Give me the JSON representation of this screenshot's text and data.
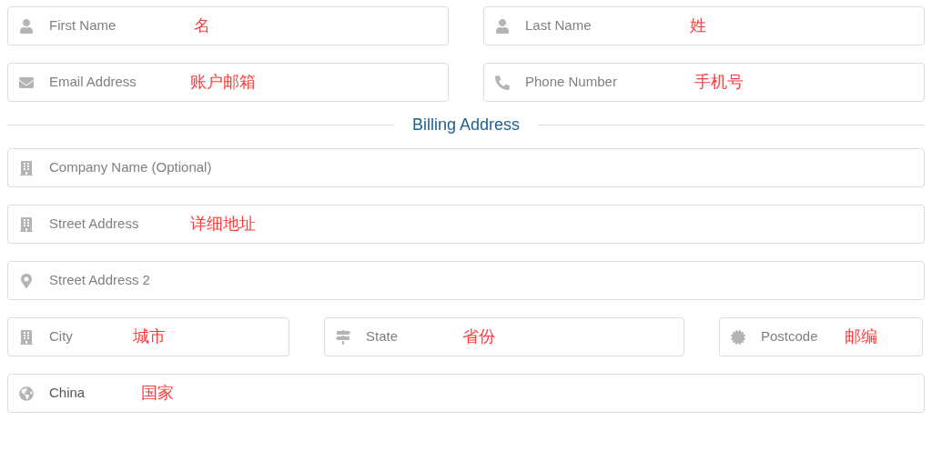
{
  "contact_rows": [
    [
      {
        "kind": "person",
        "placeholder": "First Name",
        "annotation": "名"
      },
      {
        "kind": "person",
        "placeholder": "Last Name",
        "annotation": "姓"
      }
    ],
    [
      {
        "kind": "mail",
        "placeholder": "Email Address",
        "annotation": "账户邮箱"
      },
      {
        "kind": "phone",
        "placeholder": "Phone Number",
        "annotation": "手机号"
      }
    ]
  ],
  "billing": {
    "title": "Billing Address",
    "rows": [
      [
        {
          "kind": "building",
          "placeholder": "Company Name (Optional)"
        }
      ],
      [
        {
          "kind": "building",
          "placeholder": "Street Address",
          "annotation": "详细地址"
        }
      ],
      [
        {
          "kind": "pin",
          "placeholder": "Street Address 2"
        }
      ],
      [
        {
          "kind": "building",
          "placeholder": "City",
          "annotation": "城市"
        },
        {
          "kind": "signpost",
          "placeholder": "State",
          "annotation": "省份"
        },
        {
          "kind": "seal",
          "placeholder": "Postcode",
          "annotation": "邮编"
        }
      ],
      [
        {
          "kind": "globe",
          "value": "China",
          "annotation": "国家"
        }
      ]
    ]
  }
}
